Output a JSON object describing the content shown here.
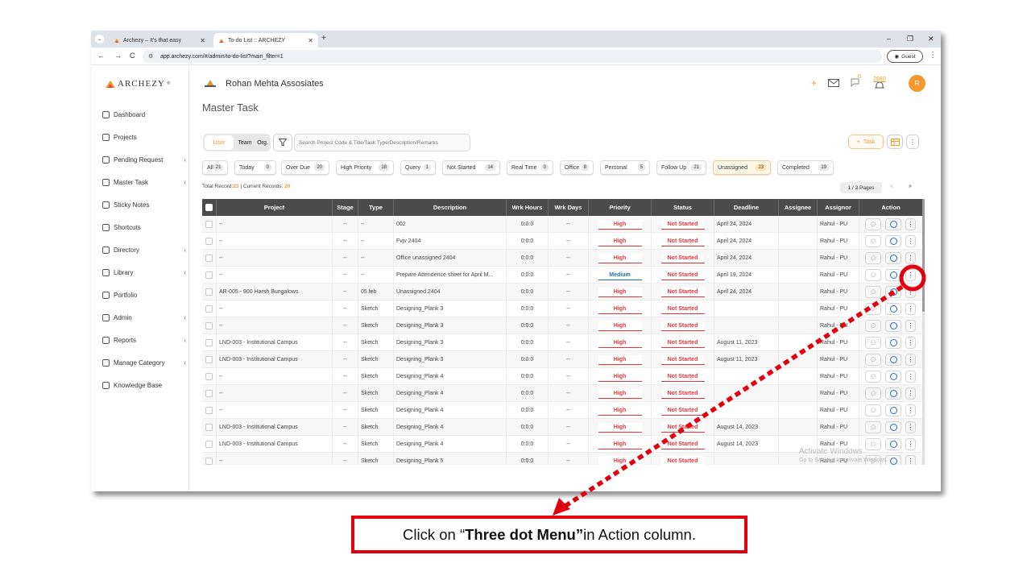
{
  "browser": {
    "tabs": [
      {
        "title": "Archezy – It's that easy",
        "active": false
      },
      {
        "title": "To-do List :: ARCHEZY",
        "active": true
      }
    ],
    "url": "app.archezy.com/#/admin/to-do-list?main_filter=1",
    "profile_label": "Guest"
  },
  "sidebar": {
    "brand": "ARCHEZY",
    "brand_mark": "®",
    "items": [
      {
        "label": "Dashboard",
        "icon": "home-icon",
        "chevron": false
      },
      {
        "label": "Projects",
        "icon": "projects-icon",
        "chevron": false
      },
      {
        "label": "Pending Request",
        "icon": "pending-request-icon",
        "chevron": true
      },
      {
        "label": "Master Task",
        "icon": "master-task-icon",
        "chevron": true
      },
      {
        "label": "Sticky Notes",
        "icon": "sticky-notes-icon",
        "chevron": false
      },
      {
        "label": "Shortcuts",
        "icon": "shortcuts-icon",
        "chevron": false
      },
      {
        "label": "Directory",
        "icon": "directory-icon",
        "chevron": true
      },
      {
        "label": "Library",
        "icon": "library-icon",
        "chevron": true
      },
      {
        "label": "Portfolio",
        "icon": "portfolio-icon",
        "chevron": false
      },
      {
        "label": "Admin",
        "icon": "admin-icon",
        "chevron": true
      },
      {
        "label": "Reports",
        "icon": "reports-icon",
        "chevron": true
      },
      {
        "label": "Manage Category",
        "icon": "manage-category-icon",
        "chevron": true
      },
      {
        "label": "Knowledge Base",
        "icon": "knowledge-base-icon",
        "chevron": false
      }
    ]
  },
  "header": {
    "org_name": "Rohan Mehta Assosiates",
    "notification_count": "0",
    "year_badge": "2080",
    "avatar_initial": "R"
  },
  "page": {
    "title": "Master Task",
    "segments": [
      "User",
      "Team",
      "Org."
    ],
    "search_placeholder": "Search Project Code & Title/Task Type/Description/Remarks",
    "add_task_label": "Task"
  },
  "filters": [
    {
      "label": "All",
      "count": "21"
    },
    {
      "label": "Today",
      "count": "0"
    },
    {
      "label": "Over Due",
      "count": "20"
    },
    {
      "label": "High Priority",
      "count": "18"
    },
    {
      "label": "Query",
      "count": "1"
    },
    {
      "label": "Not Started",
      "count": "14"
    },
    {
      "label": "Real Time",
      "count": "0"
    },
    {
      "label": "Office",
      "count": "8"
    },
    {
      "label": "Personal",
      "count": "5"
    },
    {
      "label": "Follow Up",
      "count": "21"
    },
    {
      "label": "Unassigned",
      "count": "23"
    },
    {
      "label": "Completed",
      "count": "19"
    }
  ],
  "records": {
    "total_label": "Total Record:",
    "total": "23",
    "current_label": "| Current Records:",
    "current": "20",
    "pages": "1 / 2 Pages",
    "prev": "«",
    "next": "»"
  },
  "table": {
    "columns": [
      "Project",
      "Stage",
      "Type",
      "Description",
      "Wrk Hours",
      "Wrk Days",
      "Priority",
      "Status",
      "Deadline",
      "Assignee",
      "Assignor",
      "Action"
    ],
    "rows": [
      {
        "project": "--",
        "stage": "--",
        "type": "--",
        "description": "002",
        "hours": "0:0:0",
        "days": "--",
        "priority": "High",
        "status": "Not Started",
        "deadline": "April 24, 2024",
        "assignee": "",
        "assignor": "Rahul - PU"
      },
      {
        "project": "--",
        "stage": "--",
        "type": "--",
        "description": "Fvjv 2404",
        "hours": "0:0:0",
        "days": "--",
        "priority": "High",
        "status": "Not Started",
        "deadline": "April 24, 2024",
        "assignee": "",
        "assignor": "Rahul - PU"
      },
      {
        "project": "--",
        "stage": "--",
        "type": "--",
        "description": "Office unassigned 2404",
        "hours": "0:0:0",
        "days": "--",
        "priority": "High",
        "status": "Not Started",
        "deadline": "April 24, 2024",
        "assignee": "",
        "assignor": "Rahul - PU"
      },
      {
        "project": "--",
        "stage": "--",
        "type": "--",
        "description": "Prepare Attendence sheet for April M...",
        "hours": "0:0:0",
        "days": "--",
        "priority": "Medium",
        "status": "Not Started",
        "deadline": "April 19, 2024",
        "assignee": "",
        "assignor": "Rahul - PU"
      },
      {
        "project": "AR-005 - 900 Harsh Bungalows",
        "stage": "--",
        "type": "05 feb",
        "description": "Unassigned 2404",
        "hours": "0:0:0",
        "days": "--",
        "priority": "High",
        "status": "Not Started",
        "deadline": "April 24, 2024",
        "assignee": "",
        "assignor": "Rahul - PU"
      },
      {
        "project": "--",
        "stage": "--",
        "type": "Sketch",
        "description": "Designing_Plank 3",
        "hours": "0:0:0",
        "days": "--",
        "priority": "High",
        "status": "Not Started",
        "deadline": "",
        "assignee": "",
        "assignor": "Rahul - PU"
      },
      {
        "project": "--",
        "stage": "--",
        "type": "Sketch",
        "description": "Designing_Plank 3",
        "hours": "0:0:0",
        "days": "--",
        "priority": "High",
        "status": "Not Started",
        "deadline": "",
        "assignee": "",
        "assignor": "Rahul - PU"
      },
      {
        "project": "LND-003 - Institutional Campus",
        "stage": "--",
        "type": "Sketch",
        "description": "Designing_Plank 3",
        "hours": "0:0:0",
        "days": "--",
        "priority": "High",
        "status": "Not Started",
        "deadline": "August 11, 2023",
        "assignee": "",
        "assignor": "Rahul - PU"
      },
      {
        "project": "LND-003 - Institutional Campus",
        "stage": "--",
        "type": "Sketch",
        "description": "Designing_Plank 3",
        "hours": "0:0:0",
        "days": "--",
        "priority": "High",
        "status": "Not Started",
        "deadline": "August 11, 2023",
        "assignee": "",
        "assignor": "Rahul - PU"
      },
      {
        "project": "--",
        "stage": "--",
        "type": "Sketch",
        "description": "Designing_Plank 4",
        "hours": "0:0:0",
        "days": "--",
        "priority": "High",
        "status": "Not Started",
        "deadline": "",
        "assignee": "",
        "assignor": "Rahul - PU"
      },
      {
        "project": "--",
        "stage": "--",
        "type": "Sketch",
        "description": "Designing_Plank 4",
        "hours": "0:0:0",
        "days": "--",
        "priority": "High",
        "status": "Not Started",
        "deadline": "",
        "assignee": "",
        "assignor": "Rahul - PU"
      },
      {
        "project": "--",
        "stage": "--",
        "type": "Sketch",
        "description": "Designing_Plank 4",
        "hours": "0:0:0",
        "days": "--",
        "priority": "High",
        "status": "Not Started",
        "deadline": "",
        "assignee": "",
        "assignor": "Rahul - PU"
      },
      {
        "project": "LND-003 - Institutional Campus",
        "stage": "--",
        "type": "Sketch",
        "description": "Designing_Plank 4",
        "hours": "0:0:0",
        "days": "--",
        "priority": "High",
        "status": "Not Started",
        "deadline": "August 14, 2023",
        "assignee": "",
        "assignor": "Rahul - PU"
      },
      {
        "project": "LND-003 - Institutional Campus",
        "stage": "--",
        "type": "Sketch",
        "description": "Designing_Plank 4",
        "hours": "0:0:0",
        "days": "--",
        "priority": "High",
        "status": "Not Started",
        "deadline": "August 14, 2023",
        "assignee": "",
        "assignor": "Rahul - PU"
      },
      {
        "project": "--",
        "stage": "--",
        "type": "Sketch",
        "description": "Designing_Plank 5",
        "hours": "0:0:0",
        "days": "--",
        "priority": "High",
        "status": "Not Started",
        "deadline": "",
        "assignee": "",
        "assignor": "Rahul - PU"
      }
    ]
  },
  "watermark": {
    "line1": "Activate Windows",
    "line2": "Go to Settings to activate Windows."
  },
  "callout": {
    "prefix": "Click on “",
    "bold": "Three dot Menu”",
    "suffix": " in Action column."
  },
  "colors": {
    "accent": "#f39a2e",
    "priority_high": "#e0363c",
    "priority_medium": "#1c6fc4",
    "annotation_red": "#e2000f",
    "table_header": "#4b4b4b"
  }
}
